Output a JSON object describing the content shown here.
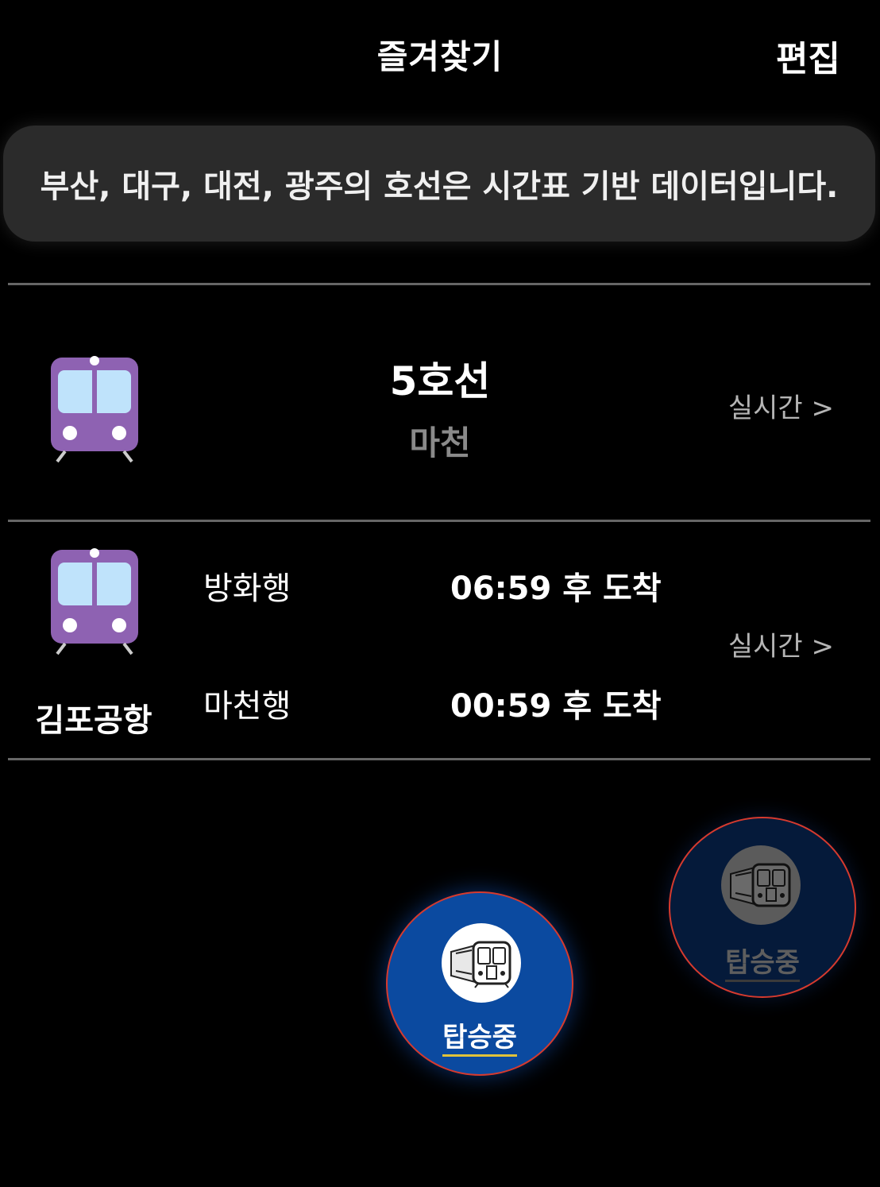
{
  "header": {
    "title": "즐겨찾기",
    "edit_label": "편집"
  },
  "notice": {
    "text": "부산, 대구, 대전, 광주의 호선은 시간표 기반 데이터입니다."
  },
  "favorites": [
    {
      "line": "5호선",
      "station": "마천",
      "realtime_label": "실시간 >"
    },
    {
      "station": "김포공항",
      "realtime_label": "실시간 >",
      "arrivals": [
        {
          "direction": "방화행",
          "time": "06:59 후 도착"
        },
        {
          "direction": "마천행",
          "time": "00:59 후 도착"
        }
      ]
    }
  ],
  "boarding_buttons": [
    {
      "label": "탑승중",
      "state": "active"
    },
    {
      "label": "탑승중",
      "state": "inactive"
    }
  ],
  "colors": {
    "train_purple": "#8e62b2",
    "window_blue": "#bfe3fb",
    "active_blue": "#0b4aa0",
    "border_red": "#d63a2e"
  },
  "icons": {
    "line_train": "train-front-icon",
    "boarding": "subway-train-icon"
  }
}
